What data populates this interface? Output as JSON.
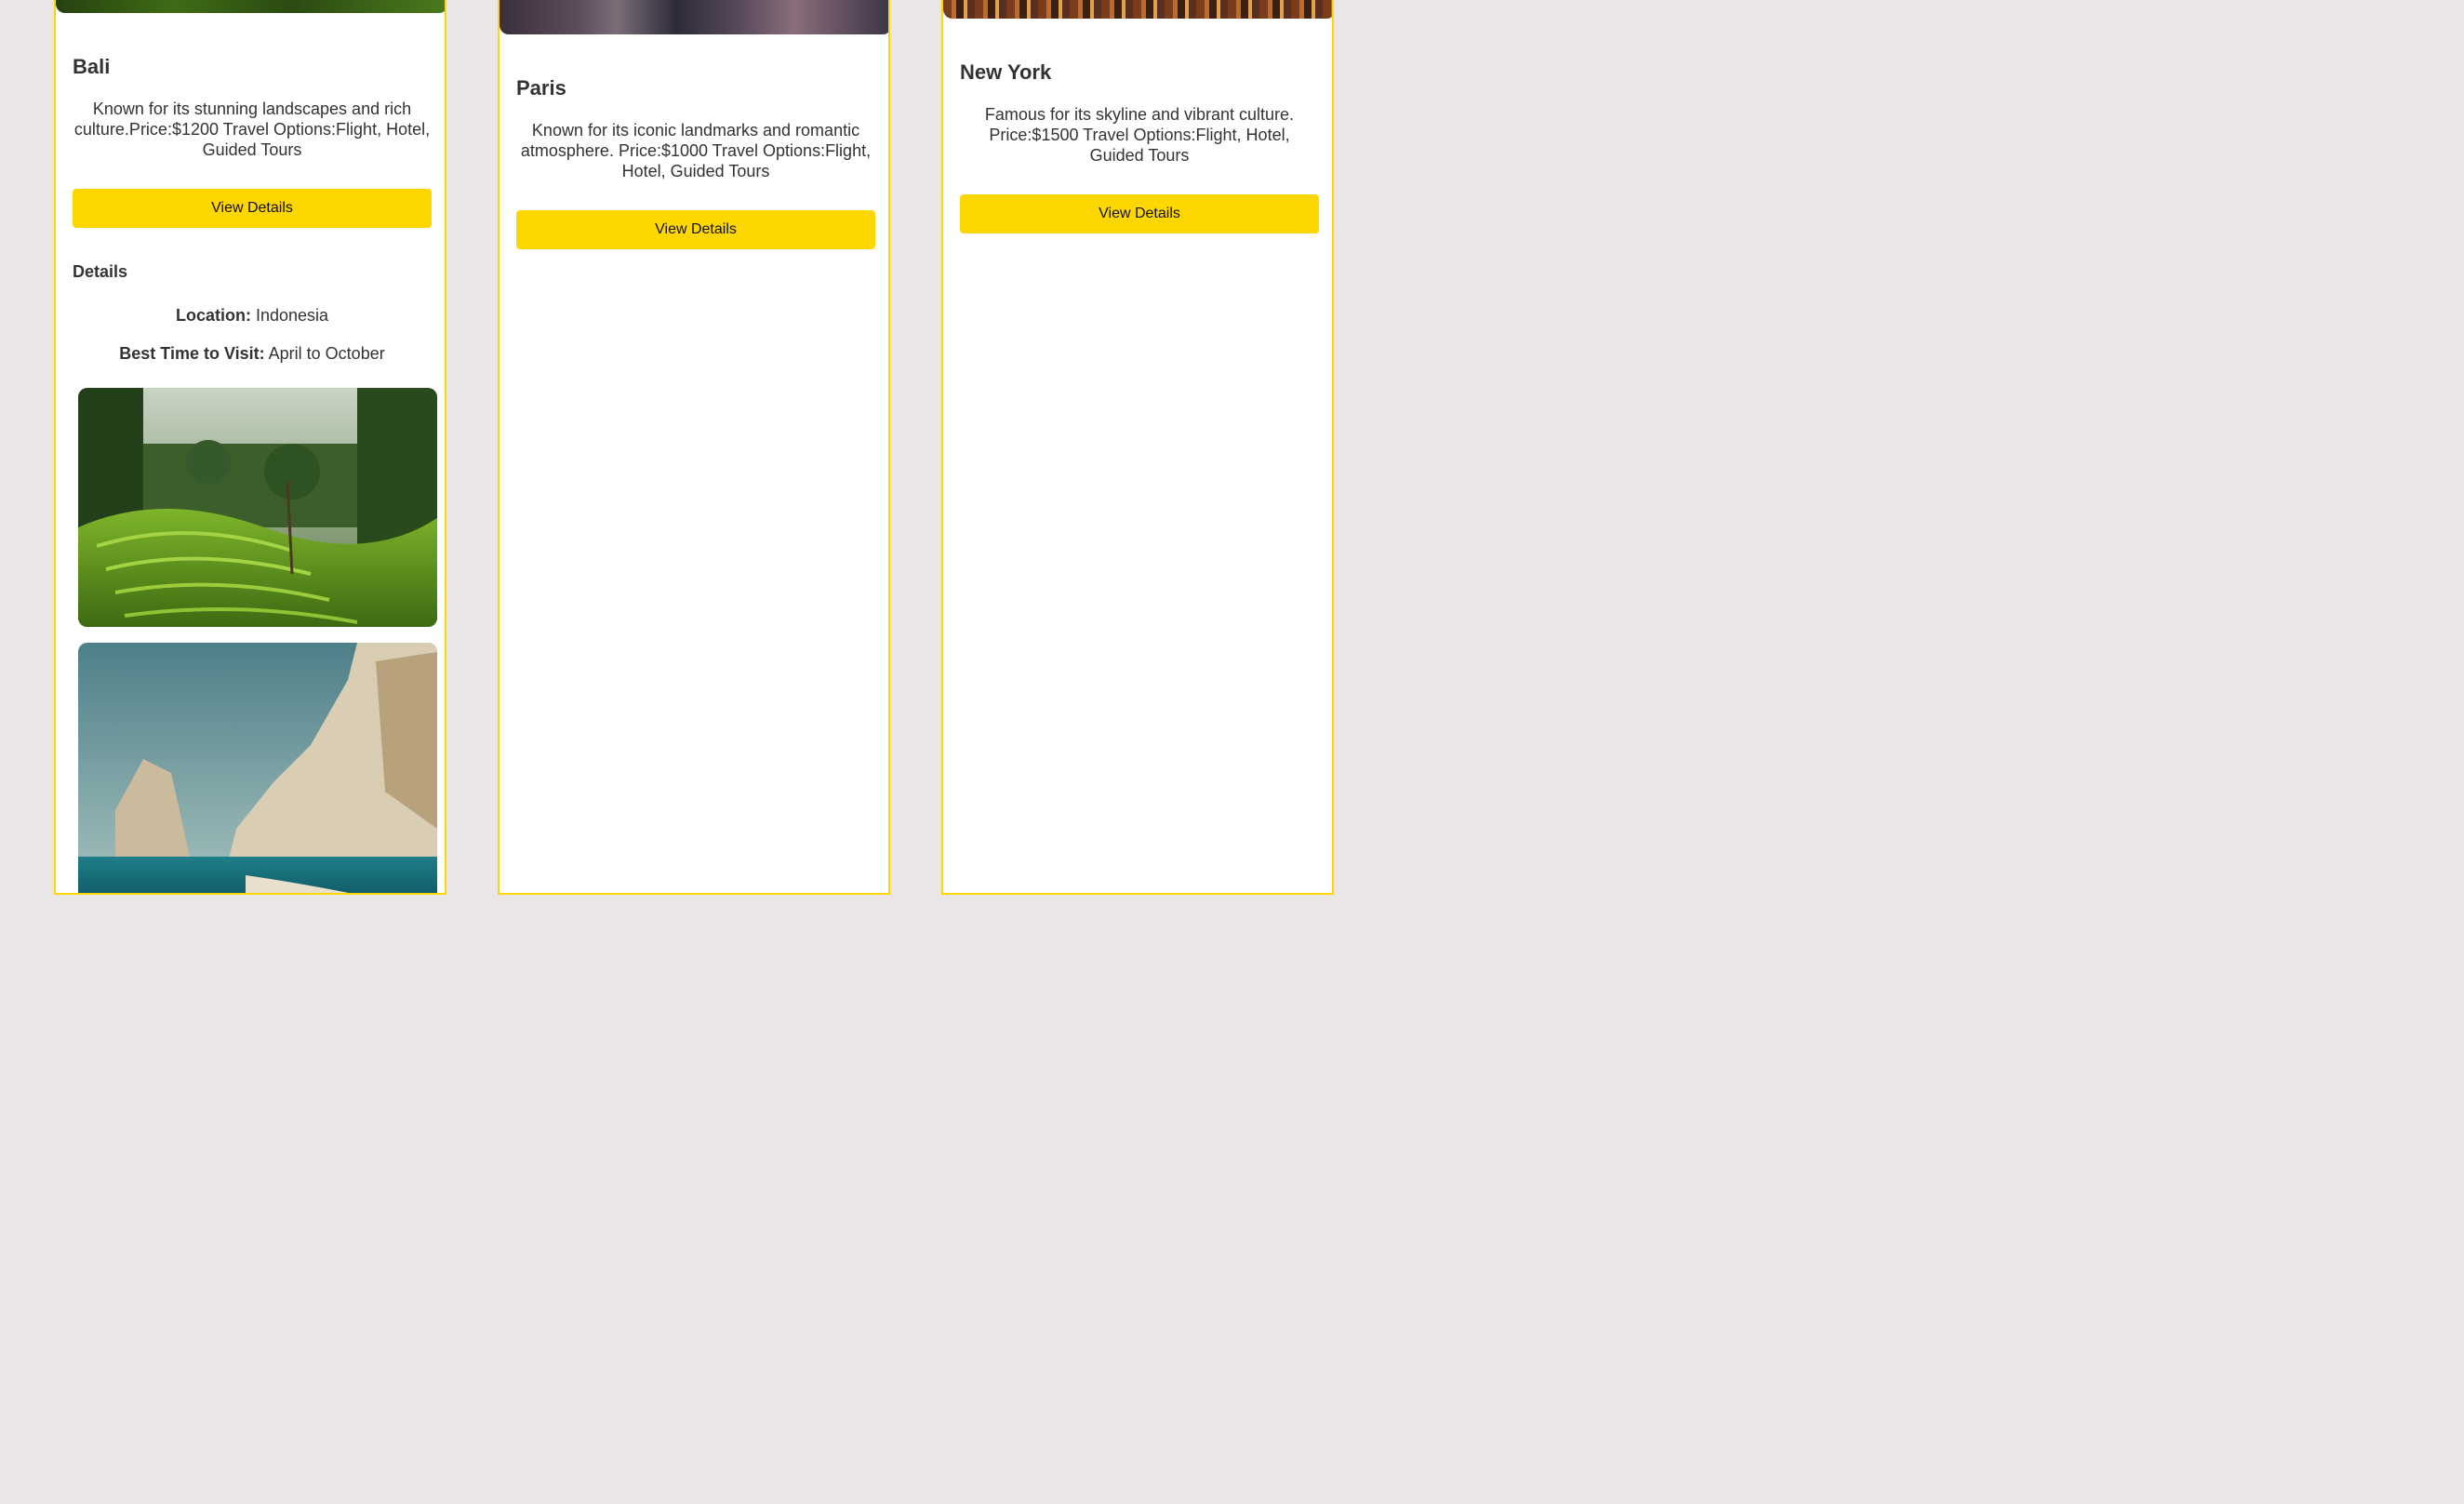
{
  "cards": [
    {
      "title": "Bali",
      "description": "Known for its stunning landscapes and rich culture.Price:$1200 Travel Options:Flight, Hotel, Guided Tours",
      "button_label": "View Details",
      "details": {
        "heading": "Details",
        "location_label": "Location:",
        "location_value": "Indonesia",
        "best_time_label": "Best Time to Visit:",
        "best_time_value": "April to October"
      },
      "gallery": [
        "rice-terraces-photo",
        "coastal-cliffs-photo"
      ]
    },
    {
      "title": "Paris",
      "description": "Known for its iconic landmarks and romantic atmosphere. Price:$1000 Travel Options:Flight, Hotel, Guided Tours",
      "button_label": "View Details"
    },
    {
      "title": "New York",
      "description": "Famous for its skyline and vibrant culture. Price:$1500 Travel Options:Flight, Hotel, Guided Tours",
      "button_label": "View Details"
    }
  ],
  "colors": {
    "accent": "#ffd700",
    "background": "#ebe6e6",
    "card": "#ffffff",
    "text": "#333333"
  }
}
